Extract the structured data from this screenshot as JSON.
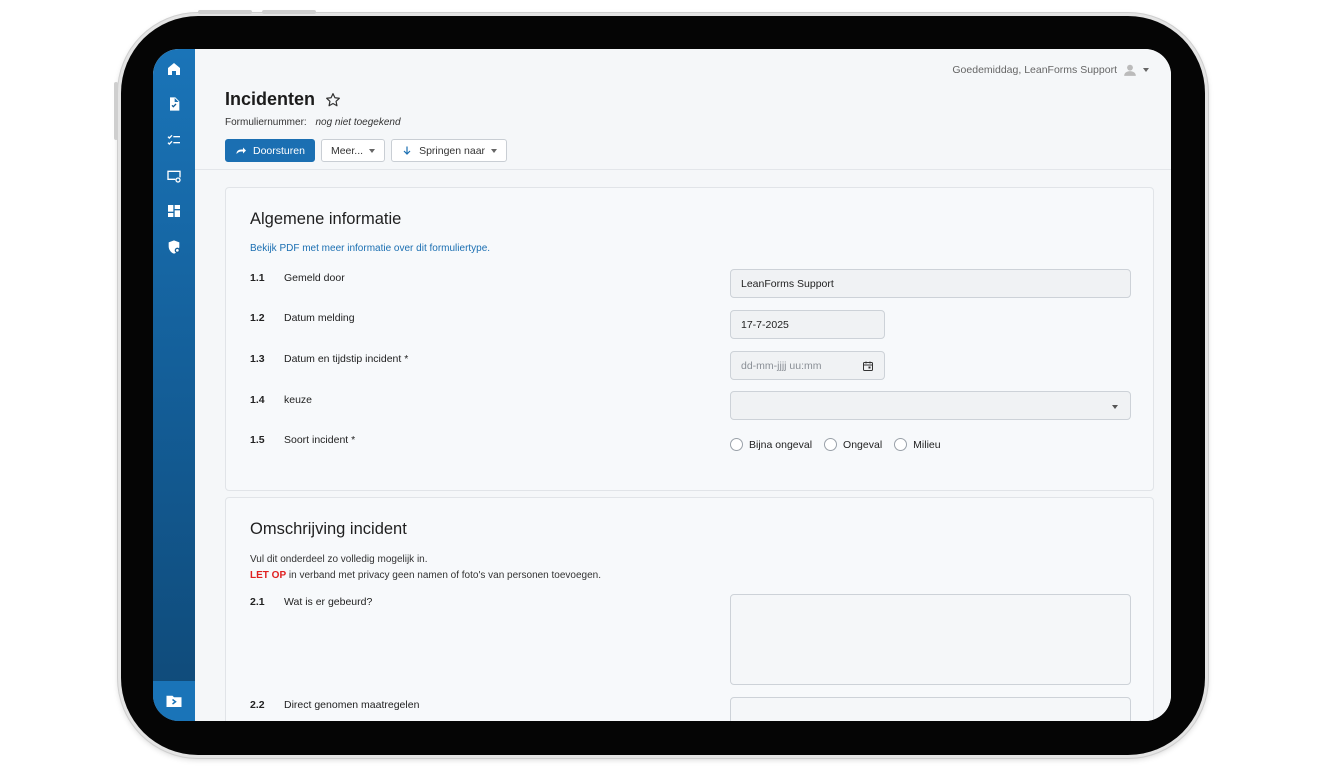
{
  "app": {
    "greeting": "Goedemiddag, LeanForms Support"
  },
  "sidebar": {
    "items": [
      {
        "icon": "home-icon"
      },
      {
        "icon": "document-icon"
      },
      {
        "icon": "checklist-icon"
      },
      {
        "icon": "device-settings-icon"
      },
      {
        "icon": "dashboard-icon"
      },
      {
        "icon": "shield-settings-icon"
      }
    ],
    "bottom_icon": "folder-arrow-icon"
  },
  "header": {
    "title": "Incidenten",
    "form_number_label": "Formuliernummer:",
    "form_number_value": "nog niet toegekend"
  },
  "toolbar": {
    "forward_label": "Doorsturen",
    "more_label": "Meer...",
    "jump_label": "Springen naar"
  },
  "section1": {
    "title": "Algemene informatie",
    "link": "Bekijk PDF met meer informatie over dit formuliertype.",
    "rows": [
      {
        "num": "1.1",
        "label": "Gemeld door",
        "value": "LeanForms Support"
      },
      {
        "num": "1.2",
        "label": "Datum melding",
        "value": "17-7-2025"
      },
      {
        "num": "1.3",
        "label": "Datum en tijdstip incident *",
        "placeholder": "dd-mm-jjjj uu:mm"
      },
      {
        "num": "1.4",
        "label": "keuze",
        "value": ""
      },
      {
        "num": "1.5",
        "label": "Soort incident *",
        "options": [
          "Bijna ongeval",
          "Ongeval",
          "Milieu"
        ]
      }
    ]
  },
  "section2": {
    "title": "Omschrijving incident",
    "desc_line1": "Vul dit onderdeel zo volledig mogelijk in.",
    "warn": "LET OP",
    "desc_line2": " in verband met privacy geen namen of foto's van personen toevoegen.",
    "rows": [
      {
        "num": "2.1",
        "label": "Wat is er gebeurd?"
      },
      {
        "num": "2.2",
        "label": "Direct genomen maatregelen"
      }
    ]
  },
  "colors": {
    "primary": "#1b6fb2",
    "sidebar": "#135c95",
    "warning": "#e02020"
  }
}
